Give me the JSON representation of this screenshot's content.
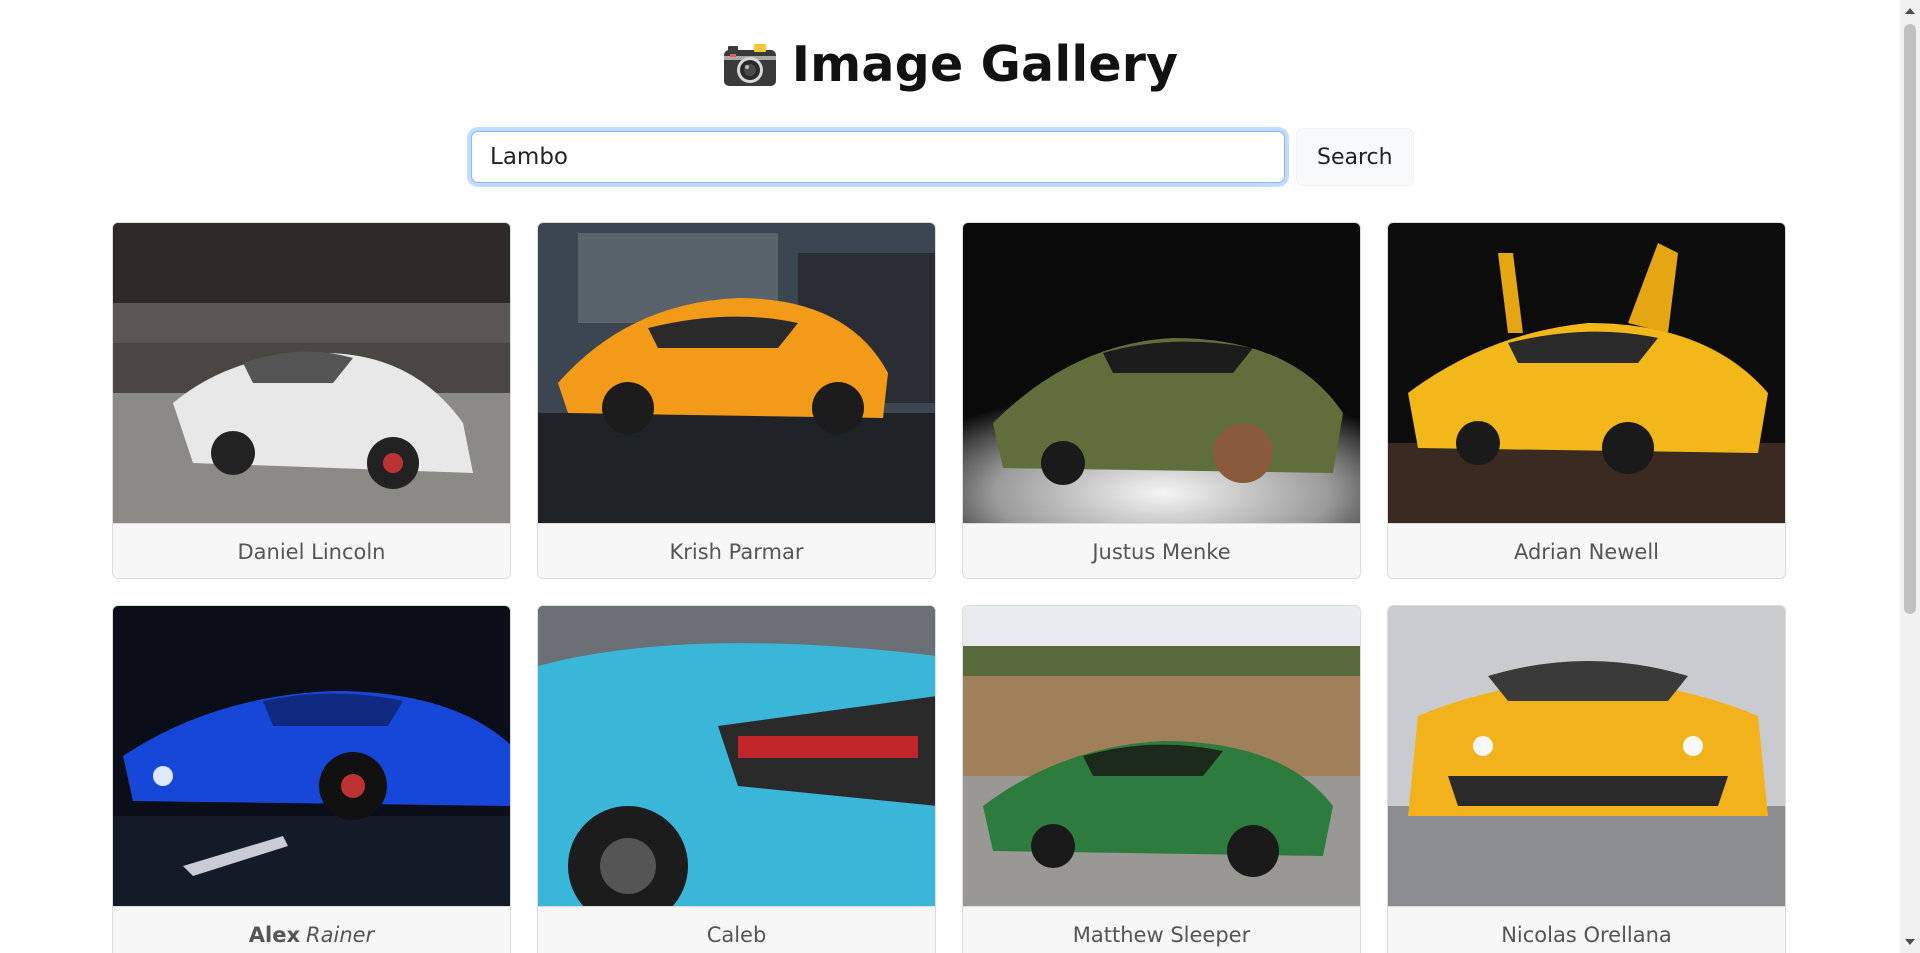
{
  "header": {
    "title": "Image Gallery",
    "icon": "camera-icon"
  },
  "search": {
    "value": "Lambo",
    "button_label": "Search"
  },
  "gallery": {
    "cards": [
      {
        "caption": "Daniel Lincoln",
        "color": "#e8e8e8"
      },
      {
        "caption": "Krish Parmar",
        "color": "#f39a18"
      },
      {
        "caption": "Justus Menke",
        "color": "#5f6e3a"
      },
      {
        "caption": "Adrian Newell",
        "color": "#f2b81a"
      },
      {
        "caption_bold": "Alex",
        "caption_italic": "Rainer",
        "color": "#1747d8"
      },
      {
        "caption": "Caleb",
        "color": "#3ab6d8"
      },
      {
        "caption": "Matthew Sleeper",
        "color": "#2e7b3e"
      },
      {
        "caption": "Nicolas Orellana",
        "color": "#f2b21c"
      }
    ]
  }
}
